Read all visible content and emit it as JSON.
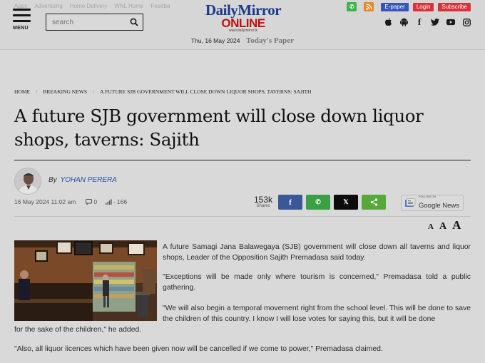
{
  "header": {
    "top_links": [
      "Apps",
      "Advertising",
      "Home Delivery",
      "WNL Home",
      "Feedba"
    ],
    "menu_label": "MENU",
    "search_placeholder": "search",
    "logo": {
      "line1": "DailyMirror",
      "line2": "ONLINE",
      "line3": "www.dailymirror.lk"
    },
    "date": "Thu, 16 May 2024",
    "todays_paper": "Today's Paper",
    "buttons": {
      "epaper": "E-paper",
      "login": "Login",
      "subscribe": "Subscribe"
    },
    "social_icons": [
      "apple-icon",
      "android-icon",
      "facebook-icon",
      "twitter-icon",
      "youtube-icon",
      "instagram-icon"
    ],
    "colors": {
      "epaper": "#3555b8",
      "login": "#d8333a",
      "subscribe": "#d8333a",
      "whatsapp": "#3ab34a",
      "rss": "#e8872a"
    }
  },
  "article": {
    "breadcrumb": [
      "HOME",
      "BREAKING NEWS",
      "A FUTURE SJB GOVERNMENT WILL CLOSE DOWN LIQUOR SHOPS, TAVERNS: SAJITH"
    ],
    "headline": "A future SJB government will close down liquor shops, taverns: Sajith",
    "by": "By",
    "author": "YOHAN PERERA",
    "datetime": "16 May 2024 11:02 am",
    "comments": "0",
    "views": "166",
    "shares_count": "153k",
    "shares_label": "Shares",
    "share_buttons": [
      {
        "name": "facebook",
        "glyph": "f",
        "color": "#3a5797"
      },
      {
        "name": "whatsapp",
        "glyph": "✆",
        "color": "#3aa043"
      },
      {
        "name": "x",
        "glyph": "𝕏",
        "color": "#0c0c0c"
      },
      {
        "name": "share",
        "glyph": "<",
        "color": "#56a83a"
      }
    ],
    "google_news": {
      "small": "FOLLOW ON",
      "label": "Google News"
    },
    "text_size_labels": [
      "A",
      "A",
      "A"
    ],
    "paragraphs": [
      "A future Samagi Jana Balawegaya (SJB) government will close down all taverns and liquor shops, Leader of the Opposition Sajith Premadasa said today.",
      "\"Exceptions will be made only where tourism is concerned,\" Premadasa told a public gathering.",
      "\"We will also begin a temporal movement right from the school level. This will be done to save the children of this country. I know I will lose votes for saying this, but it will be done",
      "for the sake of the children,\" he added.",
      "\"Also, all liquor licences which have been given now will be cancelled if we come to power,\" Premadasa claimed."
    ]
  }
}
